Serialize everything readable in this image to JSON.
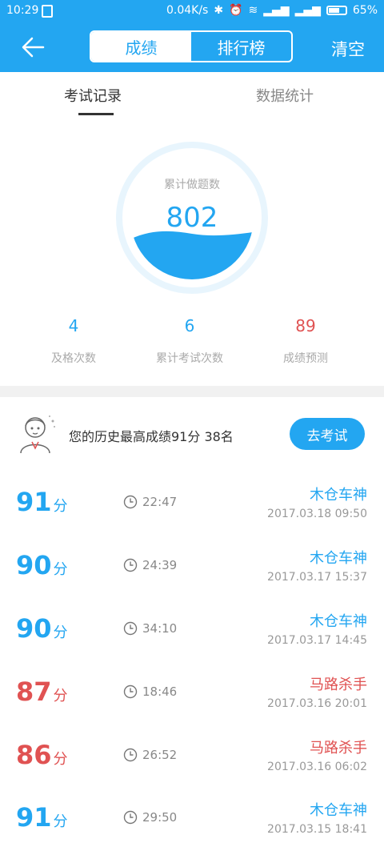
{
  "status_bar": {
    "time": "10:29",
    "speed": "0.04K/s",
    "battery": "65%",
    "battery_level": 0.65
  },
  "header": {
    "tab_scores": "成绩",
    "tab_ranking": "排行榜",
    "clear_label": "清空"
  },
  "tabs": {
    "exam_records": "考试记录",
    "data_stats": "数据统计"
  },
  "gauge": {
    "label": "累计做题数",
    "value": "802"
  },
  "stats": [
    {
      "value": "4",
      "label": "及格次数",
      "color": "#23a6f1"
    },
    {
      "value": "6",
      "label": "累计考试次数",
      "color": "#23a6f1"
    },
    {
      "value": "89",
      "label": "成绩预测",
      "color": "#e05252"
    }
  ],
  "best": {
    "text": "您的历史最高成绩91分  38名",
    "button": "去考试"
  },
  "records": [
    {
      "score": "91",
      "unit": "分",
      "duration": "22:47",
      "name": "木仓车神",
      "date": "2017.03.18  09:50",
      "color": "#23a6f1"
    },
    {
      "score": "90",
      "unit": "分",
      "duration": "24:39",
      "name": "木仓车神",
      "date": "2017.03.17  15:37",
      "color": "#23a6f1"
    },
    {
      "score": "90",
      "unit": "分",
      "duration": "34:10",
      "name": "木仓车神",
      "date": "2017.03.17  14:45",
      "color": "#23a6f1"
    },
    {
      "score": "87",
      "unit": "分",
      "duration": "18:46",
      "name": "马路杀手",
      "date": "2017.03.16  20:01",
      "color": "#e05252"
    },
    {
      "score": "86",
      "unit": "分",
      "duration": "26:52",
      "name": "马路杀手",
      "date": "2017.03.16  06:02",
      "color": "#e05252"
    },
    {
      "score": "91",
      "unit": "分",
      "duration": "29:50",
      "name": "木仓车神",
      "date": "2017.03.15  18:41",
      "color": "#23a6f1"
    }
  ],
  "colors": {
    "accent": "#23a6f1",
    "danger": "#e05252"
  }
}
